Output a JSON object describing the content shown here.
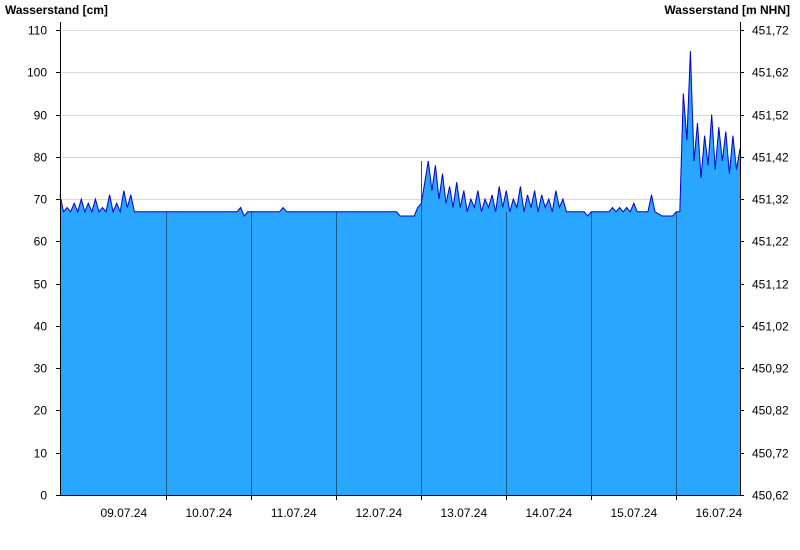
{
  "chart_data": {
    "type": "area",
    "title": "",
    "ylabel_left": "Wasserstand [cm]",
    "ylabel_right": "Wasserstand [m NHN]",
    "xlabel": "",
    "ylim": [
      0,
      110
    ],
    "y_ticks": [
      0,
      10,
      20,
      30,
      40,
      50,
      60,
      70,
      80,
      90,
      100,
      110
    ],
    "y_right_ticks": [
      "450,62",
      "450,72",
      "450,82",
      "450,92",
      "451,02",
      "451,12",
      "451,22",
      "451,32",
      "451,42",
      "451,52",
      "451,62",
      "451,72"
    ],
    "x_start": "08.07.24 18:00",
    "x_end": "16.07.24 18:00",
    "x_tick_labels": [
      "09.07.24",
      "10.07.24",
      "11.07.24",
      "12.07.24",
      "13.07.24",
      "14.07.24",
      "15.07.24",
      "16.07.24"
    ],
    "day_boundaries": [
      "10.07.24",
      "11.07.24",
      "12.07.24",
      "13.07.24",
      "14.07.24",
      "15.07.24",
      "16.07.24"
    ],
    "grid": true,
    "colors": {
      "fill": "#29a6ff",
      "line": "#0000cc",
      "grid": "#d9d9d9"
    },
    "series": [
      {
        "name": "",
        "x": [
          "08.07.24 18:00",
          "08.07.24 19:00",
          "08.07.24 20:00",
          "08.07.24 21:00",
          "08.07.24 22:00",
          "08.07.24 23:00",
          "09.07.24 00:00",
          "09.07.24 01:00",
          "09.07.24 02:00",
          "09.07.24 03:00",
          "09.07.24 04:00",
          "09.07.24 05:00",
          "09.07.24 06:00",
          "09.07.24 07:00",
          "09.07.24 08:00",
          "09.07.24 09:00",
          "09.07.24 10:00",
          "09.07.24 11:00",
          "09.07.24 12:00",
          "09.07.24 13:00",
          "09.07.24 14:00",
          "09.07.24 15:00",
          "09.07.24 16:00",
          "09.07.24 17:00",
          "09.07.24 18:00",
          "10.07.24 00:00",
          "10.07.24 12:00",
          "10.07.24 18:00",
          "10.07.24 20:00",
          "10.07.24 21:00",
          "10.07.24 22:00",
          "10.07.24 23:00",
          "11.07.24 00:00",
          "11.07.24 06:00",
          "11.07.24 08:00",
          "11.07.24 09:00",
          "11.07.24 10:00",
          "11.07.24 12:00",
          "12.07.24 00:00",
          "12.07.24 12:00",
          "12.07.24 17:00",
          "12.07.24 18:00",
          "12.07.24 20:00",
          "12.07.24 22:00",
          "12.07.24 23:00",
          "13.07.24 00:00",
          "13.07.24 02:00",
          "13.07.24 03:00",
          "13.07.24 04:00",
          "13.07.24 05:00",
          "13.07.24 06:00",
          "13.07.24 07:00",
          "13.07.24 08:00",
          "13.07.24 09:00",
          "13.07.24 10:00",
          "13.07.24 11:00",
          "13.07.24 12:00",
          "13.07.24 13:00",
          "13.07.24 14:00",
          "13.07.24 15:00",
          "13.07.24 16:00",
          "13.07.24 17:00",
          "13.07.24 18:00",
          "13.07.24 19:00",
          "13.07.24 20:00",
          "13.07.24 21:00",
          "13.07.24 22:00",
          "13.07.24 23:00",
          "14.07.24 00:00",
          "14.07.24 01:00",
          "14.07.24 02:00",
          "14.07.24 03:00",
          "14.07.24 04:00",
          "14.07.24 05:00",
          "14.07.24 06:00",
          "14.07.24 07:00",
          "14.07.24 08:00",
          "14.07.24 09:00",
          "14.07.24 10:00",
          "14.07.24 11:00",
          "14.07.24 12:00",
          "14.07.24 13:00",
          "14.07.24 14:00",
          "14.07.24 15:00",
          "14.07.24 16:00",
          "14.07.24 17:00",
          "14.07.24 18:00",
          "14.07.24 20:00",
          "14.07.24 22:00",
          "14.07.24 23:00",
          "15.07.24 00:00",
          "15.07.24 02:00",
          "15.07.24 04:00",
          "15.07.24 05:00",
          "15.07.24 06:00",
          "15.07.24 07:00",
          "15.07.24 08:00",
          "15.07.24 09:00",
          "15.07.24 10:00",
          "15.07.24 11:00",
          "15.07.24 12:00",
          "15.07.24 13:00",
          "15.07.24 14:00",
          "15.07.24 15:00",
          "15.07.24 16:00",
          "15.07.24 17:00",
          "15.07.24 18:00",
          "15.07.24 20:00",
          "15.07.24 22:00",
          "15.07.24 23:00",
          "16.07.24 00:00",
          "16.07.24 01:00",
          "16.07.24 02:00",
          "16.07.24 03:00",
          "16.07.24 04:00",
          "16.07.24 05:00",
          "16.07.24 06:00",
          "16.07.24 07:00",
          "16.07.24 08:00",
          "16.07.24 09:00",
          "16.07.24 10:00",
          "16.07.24 11:00",
          "16.07.24 12:00",
          "16.07.24 13:00",
          "16.07.24 14:00",
          "16.07.24 15:00",
          "16.07.24 16:00",
          "16.07.24 17:00",
          "16.07.24 18:00"
        ],
        "values": [
          71,
          67,
          68,
          67,
          69,
          67,
          70,
          67,
          69,
          67,
          70,
          67,
          68,
          67,
          71,
          67,
          69,
          67,
          72,
          68,
          71,
          67,
          67,
          67,
          67,
          67,
          67,
          67,
          67,
          68,
          66,
          67,
          67,
          67,
          67,
          68,
          67,
          67,
          67,
          67,
          67,
          66,
          66,
          66,
          68,
          69,
          79,
          72,
          78,
          70,
          76,
          69,
          73,
          68,
          74,
          68,
          72,
          67,
          70,
          68,
          72,
          67,
          70,
          68,
          71,
          67,
          73,
          68,
          72,
          67,
          70,
          68,
          73,
          67,
          71,
          68,
          72,
          67,
          71,
          68,
          70,
          67,
          72,
          68,
          70,
          67,
          67,
          67,
          67,
          66,
          67,
          67,
          67,
          67,
          68,
          67,
          68,
          67,
          68,
          67,
          69,
          67,
          67,
          67,
          67,
          71,
          67,
          66,
          66,
          66,
          67,
          67,
          95,
          84,
          105,
          79,
          88,
          75,
          85,
          78,
          90,
          77,
          87,
          79,
          86,
          76,
          85,
          77,
          82
        ]
      }
    ]
  }
}
